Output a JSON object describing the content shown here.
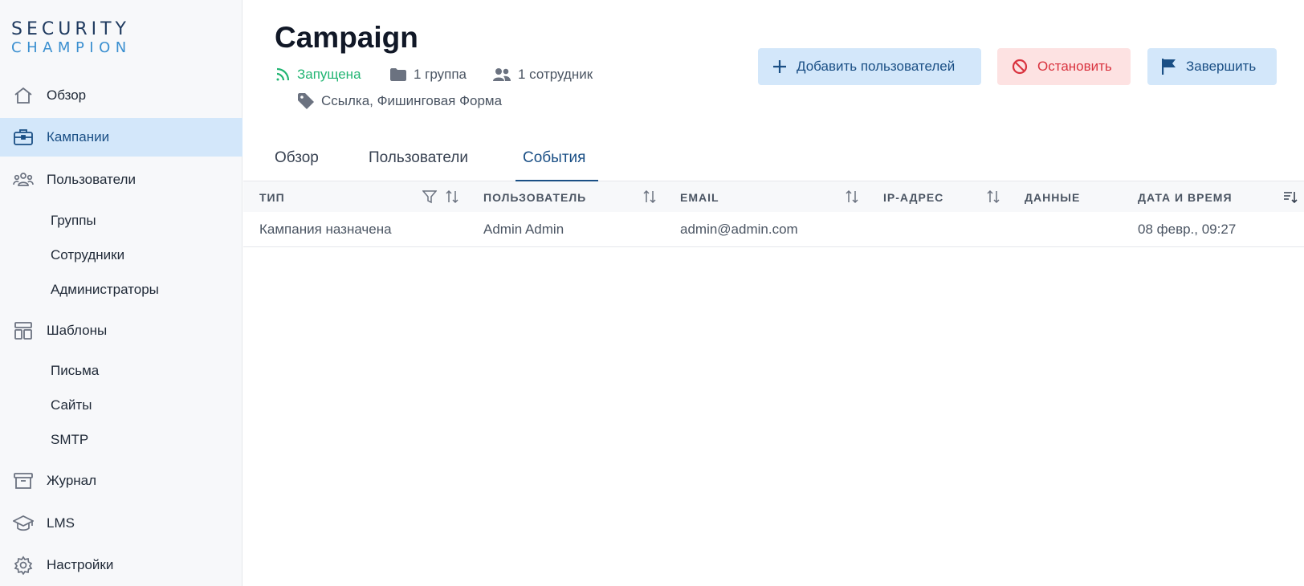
{
  "logo": {
    "line1": "SECURITY",
    "line2": "CHAMPION"
  },
  "sidebar": {
    "items": [
      {
        "label": "Обзор",
        "icon": "home-icon"
      },
      {
        "label": "Кампании",
        "icon": "briefcase-icon",
        "active": true
      },
      {
        "label": "Пользователи",
        "icon": "users-icon"
      },
      {
        "label": "Шаблоны",
        "icon": "layout-icon"
      },
      {
        "label": "Журнал",
        "icon": "archive-icon"
      },
      {
        "label": "LMS",
        "icon": "graduation-cap-icon"
      },
      {
        "label": "Настройки",
        "icon": "gear-icon"
      }
    ],
    "users_sub": [
      "Группы",
      "Сотрудники",
      "Администраторы"
    ],
    "templates_sub": [
      "Письма",
      "Сайты",
      "SMTP"
    ]
  },
  "header": {
    "title": "Campaign",
    "status": "Запущена",
    "groups": "1 группа",
    "employees": "1 сотрудник",
    "tags": "Ссылка, Фишинговая Форма"
  },
  "actions": {
    "add_users": "Добавить пользователей",
    "stop": "Остановить",
    "finish": "Завершить"
  },
  "tabs": {
    "overview": "Обзор",
    "users": "Пользователи",
    "events": "События",
    "active": "events"
  },
  "table": {
    "columns": {
      "type": "Тип",
      "user": "Пользователь",
      "email": "Email",
      "ip": "IP-адрес",
      "data": "Данные",
      "datetime": "Дата и время"
    },
    "rows": [
      {
        "type": "Кампания назначена",
        "user": "Admin Admin",
        "email": "admin@admin.com",
        "ip": "",
        "data": "",
        "datetime": "08 февр., 09:27"
      }
    ]
  },
  "colors": {
    "accent": "#1a4f85",
    "active_bg": "#d3e7fa",
    "status_green": "#22b573",
    "danger": "#d9333f"
  }
}
